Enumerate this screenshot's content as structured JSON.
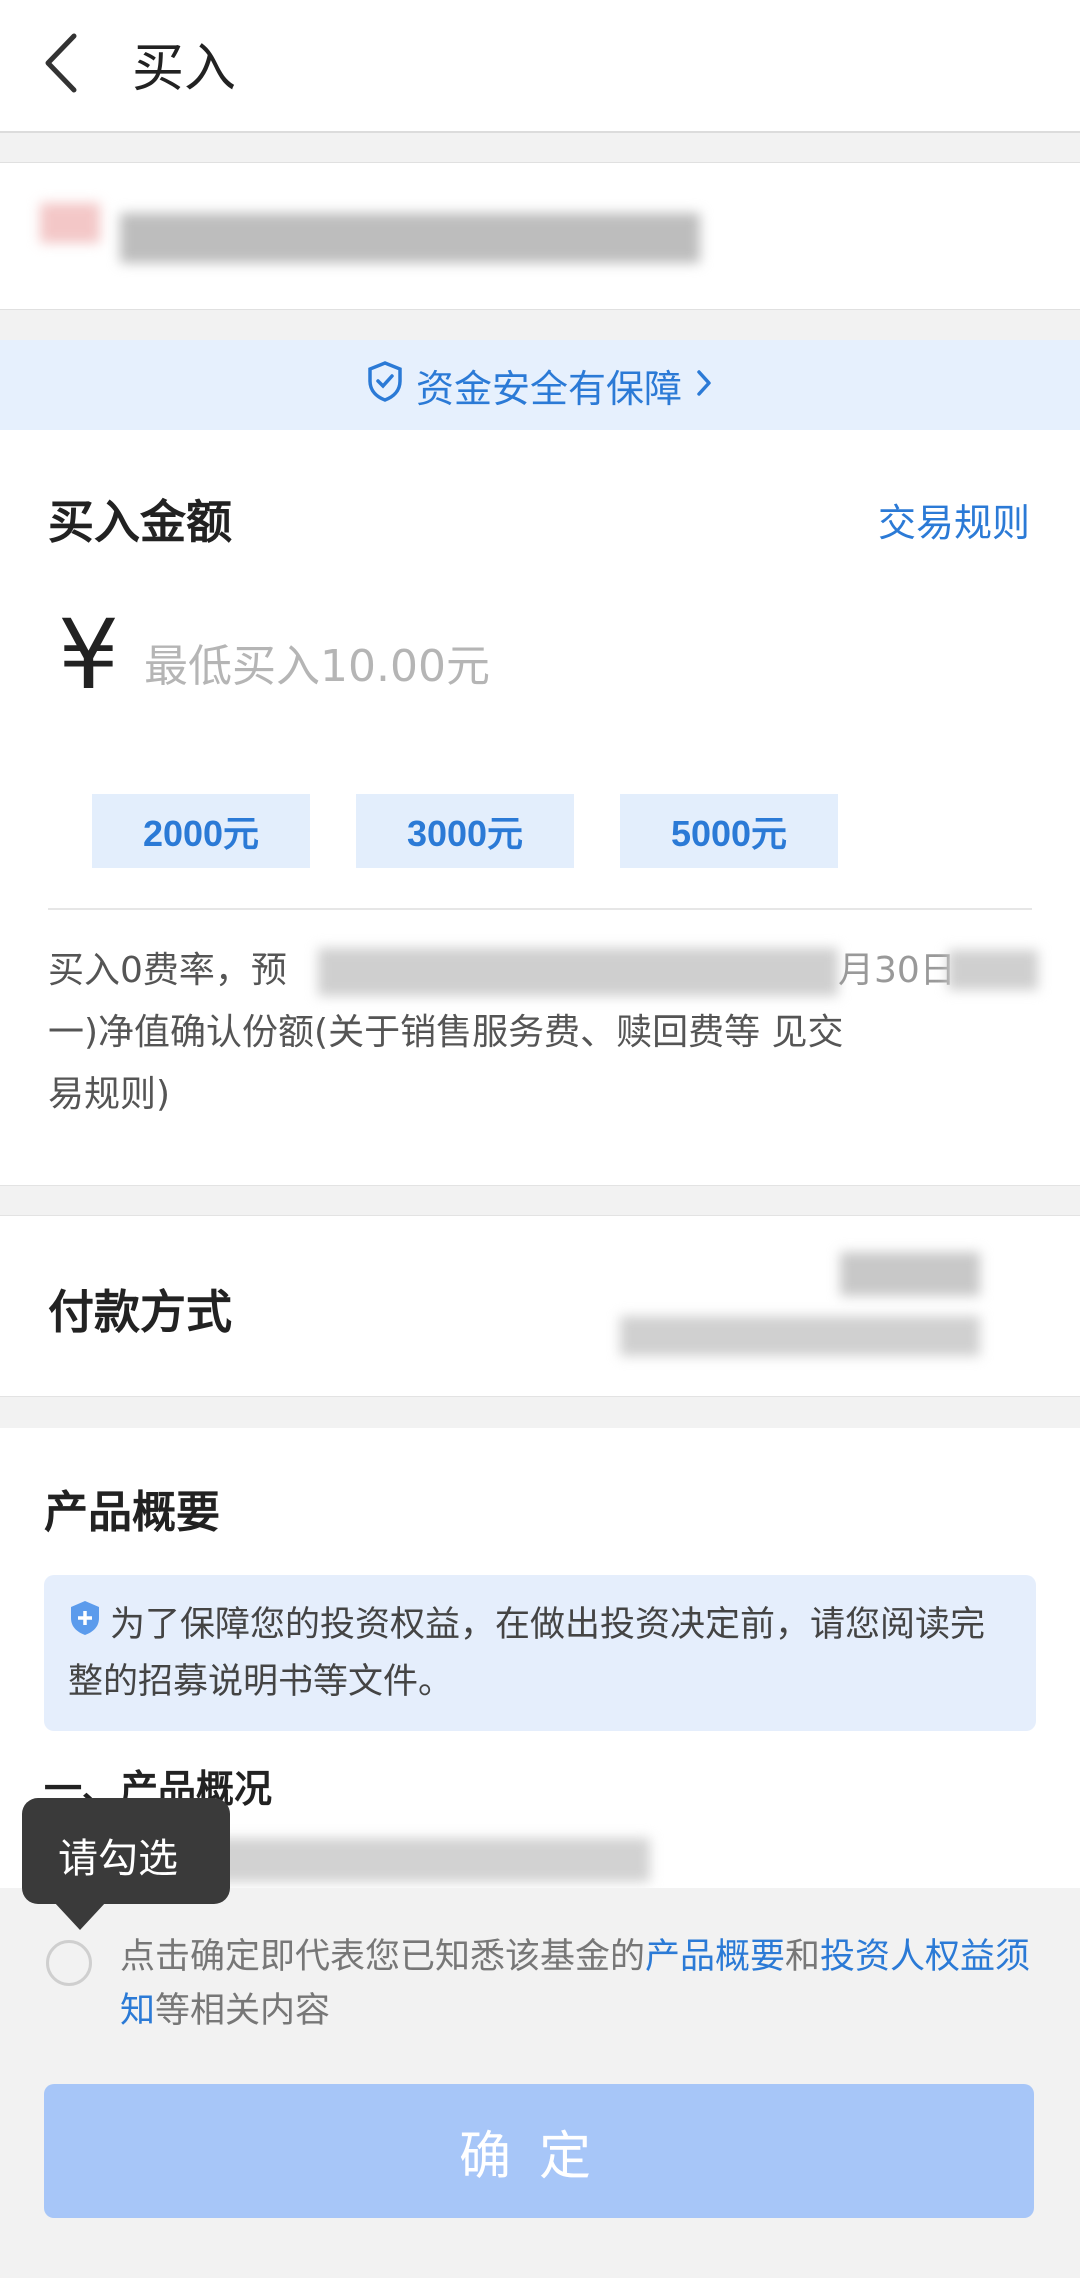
{
  "header": {
    "title": "买入"
  },
  "safety_banner": {
    "text": "资金安全有保障"
  },
  "amount_section": {
    "title": "买入金额",
    "rules_link": "交易规则",
    "currency_symbol": "¥",
    "input_placeholder": "最低买入10.00元",
    "quick_amounts": [
      "2000元",
      "3000元",
      "5000元"
    ],
    "notice_line1_start": "买入0费率，预",
    "notice_line1_end": "月30日",
    "notice_line2_start": "一)净值确认份额(关于销售服务费、赎回费等",
    "notice_line2_end": "见交",
    "notice_line3": "易规则)"
  },
  "payment": {
    "title": "付款方式"
  },
  "product_summary": {
    "title": "产品概要",
    "tip": "为了保障您的投资权益，在做出投资决定前，请您阅读完整的招募说明书等文件。",
    "subheading": "一、产品概况"
  },
  "tooltip": {
    "text": "请勾选"
  },
  "agreement": {
    "prefix": "点击确定即代表您已知悉该基金的",
    "link1": "产品概要",
    "middle": "和",
    "link2": "投资人权益须知",
    "suffix": "等相关内容"
  },
  "confirm_button": {
    "label": "确定"
  }
}
